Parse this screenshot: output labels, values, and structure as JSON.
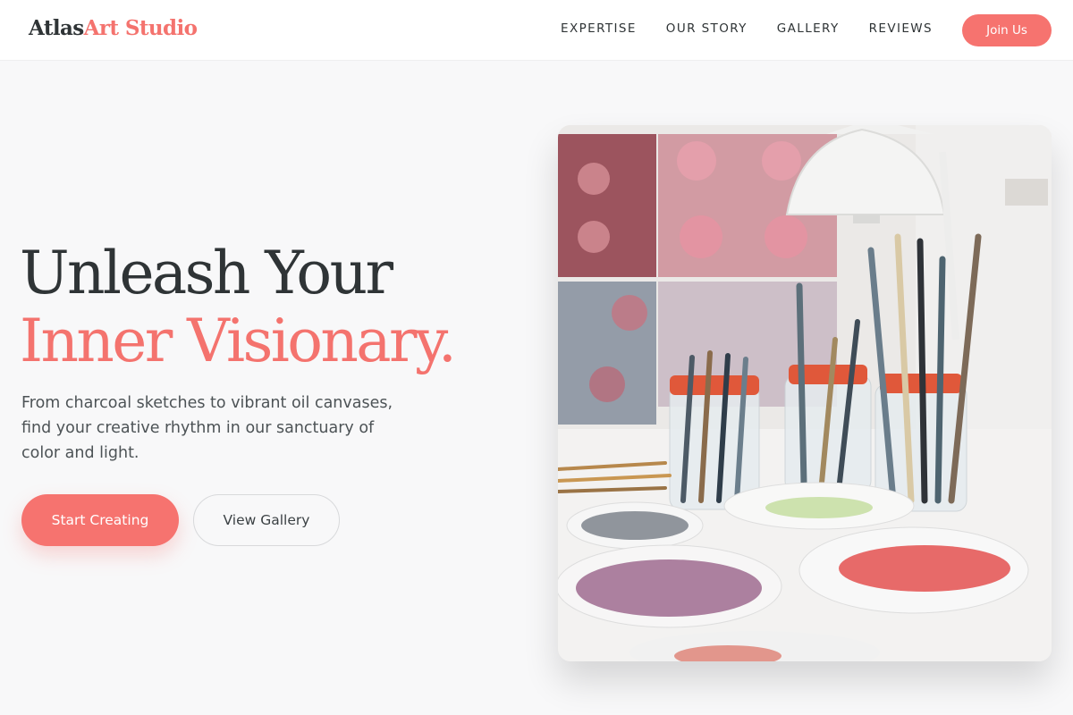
{
  "brand": {
    "name_part1": "Atlas",
    "name_part2": "Art Studio"
  },
  "nav": {
    "items": [
      {
        "label": "EXPERTISE"
      },
      {
        "label": "OUR STORY"
      },
      {
        "label": "GALLERY"
      },
      {
        "label": "REVIEWS"
      }
    ],
    "cta_label": "Join Us"
  },
  "hero": {
    "headline_line1": "Unleash Your",
    "headline_line2": "Inner Visionary.",
    "subtext": "From charcoal sketches to vibrant oil canvases, find your creative rhythm in our sanctuary of color and light.",
    "primary_button": "Start Creating",
    "secondary_button": "View Gallery",
    "image_description": "paint-brushes-in-jars-and-palette-dishes"
  },
  "colors": {
    "accent": "#f6736f",
    "dark_text": "#2f3436",
    "page_background": "#f8f8f9"
  }
}
